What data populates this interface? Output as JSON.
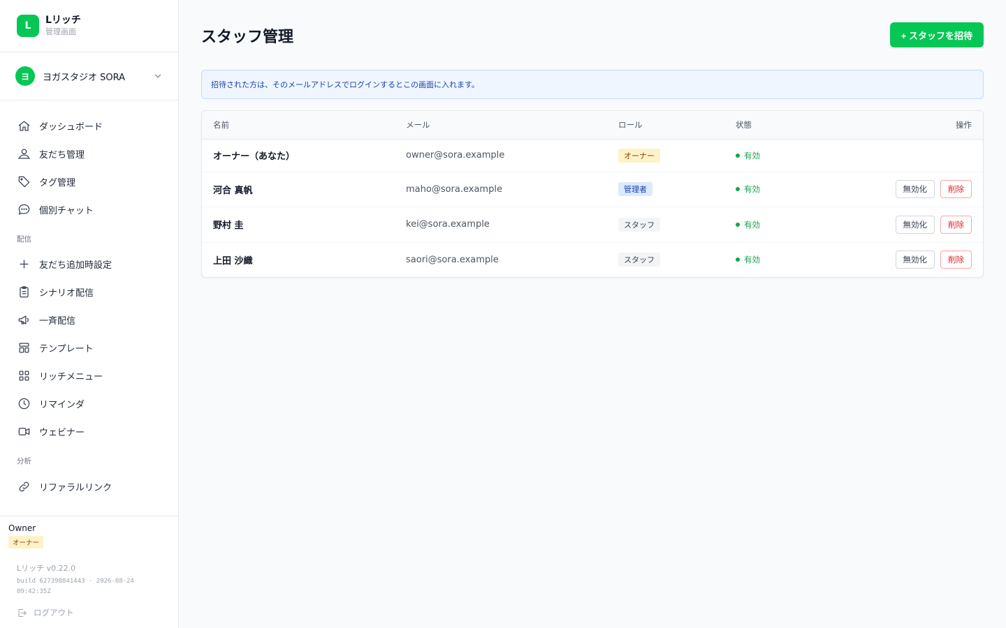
{
  "brand": {
    "logo_letter": "L",
    "name": "Lリッチ",
    "subtitle": "管理画面"
  },
  "account": {
    "avatar_letter": "ヨ",
    "name": "ヨガスタジオ SORA"
  },
  "nav": {
    "main": [
      {
        "label": "ダッシュボード",
        "icon": "home-icon"
      },
      {
        "label": "友だち管理",
        "icon": "users-icon"
      },
      {
        "label": "タグ管理",
        "icon": "tag-icon"
      },
      {
        "label": "個別チャット",
        "icon": "chat-icon"
      }
    ],
    "section_delivery": "配信",
    "delivery": [
      {
        "label": "友だち追加時設定",
        "icon": "plus-icon"
      },
      {
        "label": "シナリオ配信",
        "icon": "clipboard-icon"
      },
      {
        "label": "一斉配信",
        "icon": "megaphone-icon"
      },
      {
        "label": "テンプレート",
        "icon": "template-icon"
      },
      {
        "label": "リッチメニュー",
        "icon": "grid-icon"
      },
      {
        "label": "リマインダ",
        "icon": "clock-icon"
      },
      {
        "label": "ウェビナー",
        "icon": "video-icon"
      }
    ],
    "section_analysis": "分析",
    "analysis": [
      {
        "label": "リファラルリンク",
        "icon": "link-icon"
      }
    ]
  },
  "sidebar_footer": {
    "role_name": "Owner",
    "role_badge": "オーナー",
    "version": "Lリッチ v0.22.0",
    "build": "build 627398841443 · 2026-08-24 09:42:35Z",
    "logout_label": "ログアウト"
  },
  "page": {
    "title": "スタッフ管理",
    "invite_button": "+ スタッフを招待",
    "info": "招待された方は、そのメールアドレスでログインするとこの画面に入れます。"
  },
  "table": {
    "headers": {
      "name": "名前",
      "email": "メール",
      "role": "ロール",
      "status": "状態",
      "ops": "操作"
    },
    "disable_label": "無効化",
    "delete_label": "削除",
    "rows": [
      {
        "name": "オーナー（あなた）",
        "email": "owner@sora.example",
        "role": "オーナー",
        "role_type": "owner",
        "status": "有効",
        "actions": false
      },
      {
        "name": "河合 真帆",
        "email": "maho@sora.example",
        "role": "管理者",
        "role_type": "admin",
        "status": "有効",
        "actions": true
      },
      {
        "name": "野村 圭",
        "email": "kei@sora.example",
        "role": "スタッフ",
        "role_type": "staff",
        "status": "有効",
        "actions": true
      },
      {
        "name": "上田 沙織",
        "email": "saori@sora.example",
        "role": "スタッフ",
        "role_type": "staff",
        "status": "有効",
        "actions": true
      }
    ]
  },
  "colors": {
    "brand": "#06c755",
    "info_bg": "#eff6ff",
    "danger": "#dc2626",
    "owner_badge": "#fef3c7",
    "admin_badge": "#dbeafe"
  }
}
